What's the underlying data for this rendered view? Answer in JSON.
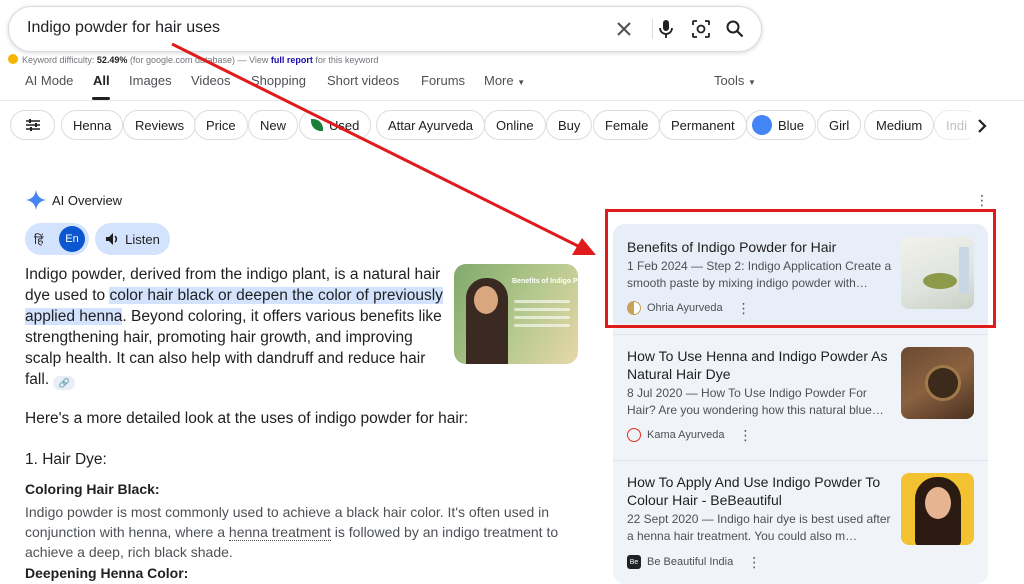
{
  "search": {
    "query": "Indigo powder for hair uses"
  },
  "keyword": {
    "label": "Keyword difficulty:",
    "value": "52.49%",
    "source": "(for google.com database) — View",
    "link": "full report",
    "suffix": "for this keyword"
  },
  "tabs": [
    {
      "label": "AI Mode"
    },
    {
      "label": "All"
    },
    {
      "label": "Images"
    },
    {
      "label": "Videos"
    },
    {
      "label": "Shopping"
    },
    {
      "label": "Short videos"
    },
    {
      "label": "Forums"
    },
    {
      "label": "More"
    }
  ],
  "tools_label": "Tools",
  "chips": [
    "Henna",
    "Reviews",
    "Price",
    "New",
    "Used",
    "Attar Ayurveda",
    "Online",
    "Buy",
    "Female",
    "Permanent",
    "Blue",
    "Girl",
    "Medium",
    "Indi"
  ],
  "ai_overview": {
    "title": "AI Overview",
    "lang_hi": "हिं",
    "lang_en": "En",
    "listen": "Listen",
    "para_1": "Indigo powder, derived from the indigo plant, is a natural hair dye used to ",
    "para_hl": "color hair black or deepen the color of previously applied henna",
    "para_2": ". Beyond coloring, it offers various benefits like strengthening hair, promoting hair growth, and improving scalp health. It can also help with dandruff and reduce hair fall.",
    "thumb_title": "Benefits of Indigo P",
    "intro": "Here's a more detailed look at the uses of indigo powder for hair:",
    "h1": "1. Hair Dye:",
    "h2": "Coloring Hair Black:",
    "body_1": "Indigo powder is most commonly used to achieve a black hair color. It's often used in conjunction with henna, where a ",
    "body_link": "henna treatment",
    "body_2": " is followed by an indigo treatment to achieve a deep, rich black shade.",
    "cut": "Deepening Henna Color:"
  },
  "results": [
    {
      "title": "Benefits of Indigo Powder for Hair",
      "snippet": "1 Feb 2024 — Step 2: Indigo Application Create a smooth paste by mixing indigo powder with…",
      "source": "Ohria Ayurveda",
      "favicon_color": "#c8a15a"
    },
    {
      "title": "How To Use Henna and Indigo Powder As Natural Hair Dye",
      "snippet": "8 Jul 2020 — How To Use Indigo Powder For Hair? Are you wondering how this natural blue…",
      "source": "Kama Ayurveda",
      "favicon_color": "#d93025"
    },
    {
      "title": "How To Apply And Use Indigo Powder To Colour Hair - BeBeautiful",
      "snippet": "22 Sept 2020 — Indigo hair dye is best used after a henna hair treatment. You could also m…",
      "source": "Be Beautiful India",
      "favicon_color": "#202124"
    }
  ],
  "colors": {
    "accent": "#0b57d0",
    "annotation_red": "#e11b1b"
  }
}
